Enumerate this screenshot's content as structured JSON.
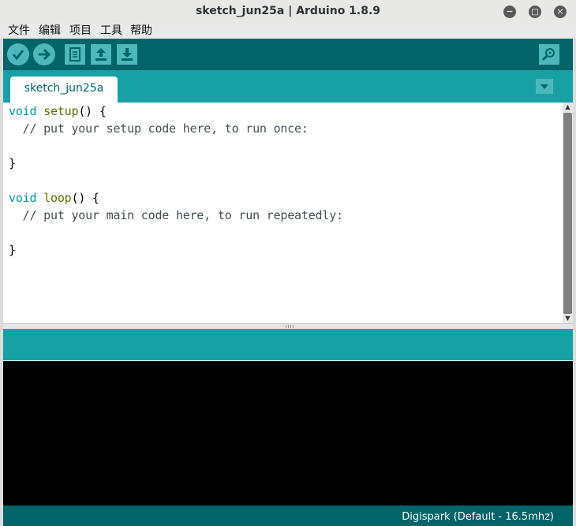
{
  "window": {
    "title": "sketch_jun25a | Arduino 1.8.9",
    "buttons": {
      "minimize": "−",
      "maximize": "□",
      "close": "×"
    }
  },
  "menubar": [
    "文件",
    "编辑",
    "项目",
    "工具",
    "帮助"
  ],
  "toolbar": {
    "icons": [
      "verify-icon",
      "upload-icon",
      "new-icon",
      "open-icon",
      "save-icon",
      "serial-monitor-icon"
    ]
  },
  "tabs": [
    {
      "label": "sketch_jun25a"
    }
  ],
  "editor": {
    "code": [
      {
        "kw": "void",
        "fn": "setup",
        "rest": "() {"
      },
      {
        "comment": "  // put your setup code here, to run once:"
      },
      {
        "plain": ""
      },
      {
        "plain": "}"
      },
      {
        "plain": ""
      },
      {
        "kw": "void",
        "fn": "loop",
        "rest": "() {"
      },
      {
        "comment": "  // put your main code here, to run repeatedly:"
      },
      {
        "plain": ""
      },
      {
        "plain": "}"
      }
    ]
  },
  "status": {
    "board": "Digispark (Default - 16.5mhz)"
  },
  "colors": {
    "toolbar_bg": "#006468",
    "tabbar_bg": "#17a1a5",
    "button_bg": "#4db7bb",
    "keyword": "#00979c",
    "function": "#5e6d03",
    "comment": "#434f54"
  }
}
